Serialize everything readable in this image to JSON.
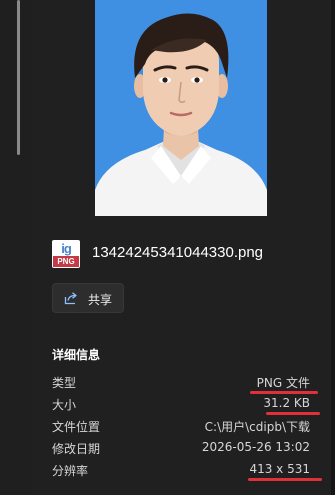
{
  "preview": {
    "background_color": "#3f8fe3",
    "subject": "id-photo-portrait"
  },
  "file": {
    "icon_label_top": "ig",
    "icon_label_tag": "PNG",
    "name": "13424245341044330.png"
  },
  "actions": {
    "share_label": "共享",
    "share_icon": "share-icon"
  },
  "details": {
    "title": "详细信息",
    "rows": [
      {
        "label": "类型",
        "value": "PNG 文件"
      },
      {
        "label": "大小",
        "value": "31.2 KB"
      },
      {
        "label": "文件位置",
        "value": "C:\\用户\\cdipb\\下载"
      },
      {
        "label": "修改日期",
        "value": "2026-05-26 13:02"
      },
      {
        "label": "分辨率",
        "value": "413 x 531"
      }
    ]
  },
  "annotations": {
    "color": "#e0303a"
  }
}
